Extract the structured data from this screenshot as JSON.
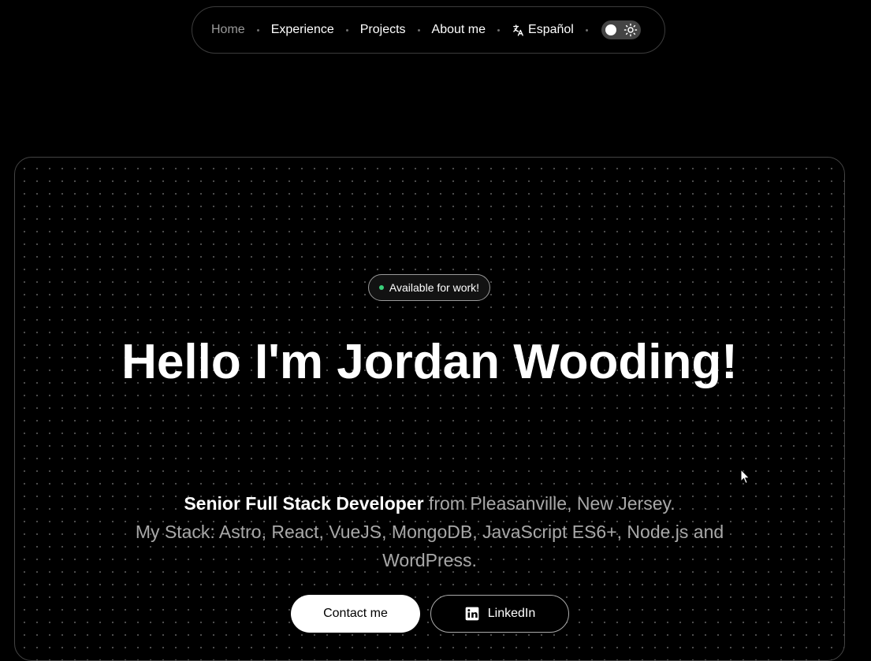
{
  "nav": {
    "items": [
      {
        "label": "Home",
        "active": true
      },
      {
        "label": "Experience"
      },
      {
        "label": "Projects"
      },
      {
        "label": "About me"
      }
    ],
    "language_label": "Español",
    "language_icon": "translate-icon",
    "theme_toggle_icon": "sun-icon"
  },
  "hero": {
    "badge": "Available for work!",
    "badge_dot_color": "#3ad07a",
    "title": "Hello I'm Jordan Wooding!",
    "role": "Senior Full Stack Developer",
    "location_text": " from Pleasanville, New Jersey.",
    "stack_text": "My Stack: Astro, React, VueJS, MongoDB, JavaScript ES6+, Node.js and WordPress.",
    "contact_label": "Contact me",
    "linkedin_label": "LinkedIn"
  }
}
